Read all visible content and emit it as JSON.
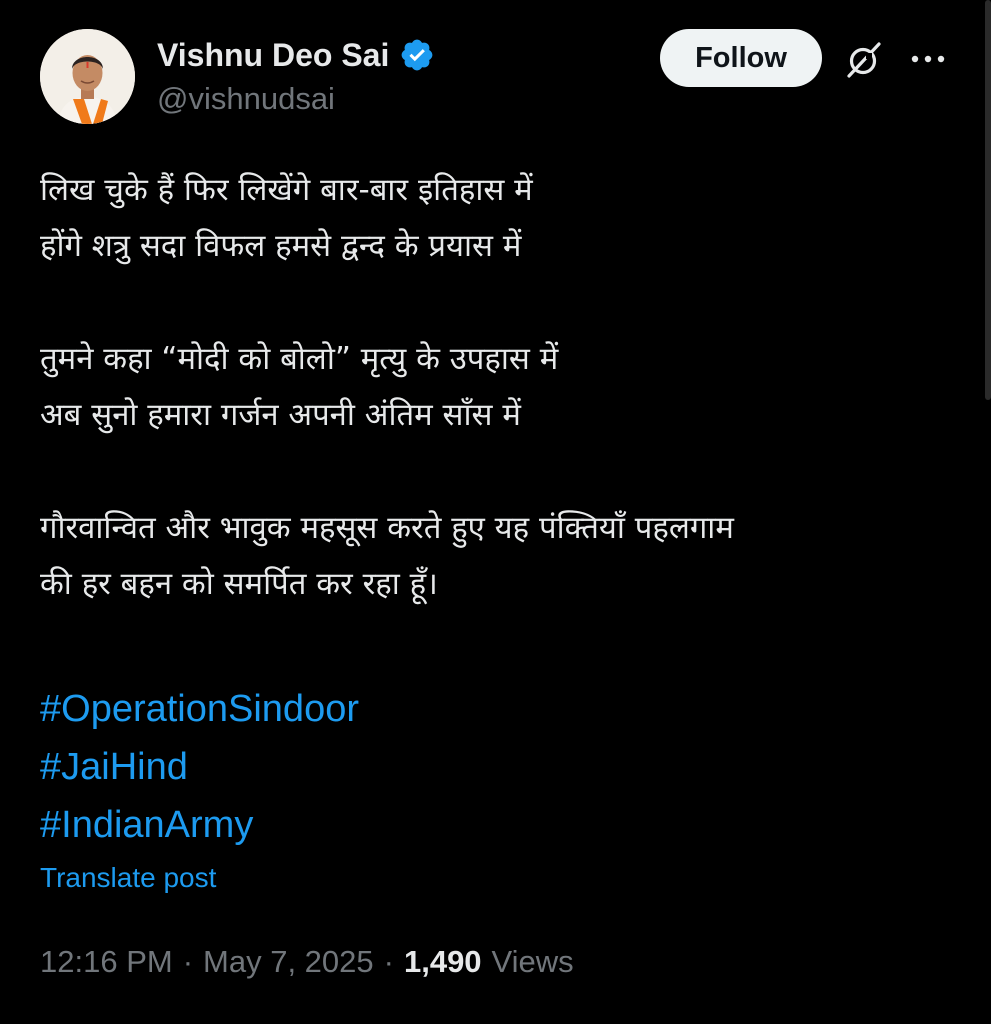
{
  "author": {
    "display_name": "Vishnu Deo Sai",
    "handle": "@vishnudsai",
    "verified": true,
    "avatar_icon": "profile-photo"
  },
  "header": {
    "follow_label": "Follow",
    "grok_icon": "grok-slash-icon",
    "more_icon": "more-dots-icon"
  },
  "post": {
    "stanzas": [
      {
        "lines": [
          "लिख चुके हैं फिर लिखेंगे बार-बार इतिहास में",
          "होंगे शत्रु सदा विफल हमसे द्वन्द के प्रयास में"
        ]
      },
      {
        "lines": [
          "तुमने कहा “मोदी को बोलो” मृत्यु के उपहास में",
          "अब सुनो हमारा गर्जन अपनी अंतिम साँस में"
        ]
      },
      {
        "lines": [
          "गौरवान्वित और भावुक महसूस करते हुए यह पंक्तियाँ पहलगाम",
          "की हर बहन को समर्पित कर रहा हूँ।"
        ]
      }
    ],
    "hashtags": [
      "#OperationSindoor",
      "#JaiHind",
      "#IndianArmy"
    ],
    "translate_label": "Translate post"
  },
  "meta": {
    "time": "12:16 PM",
    "separator": "·",
    "date": "May 7, 2025",
    "views_count": "1,490",
    "views_label": "Views"
  },
  "colors": {
    "background": "#000000",
    "text": "#e7e9ea",
    "secondary": "#71767b",
    "link": "#1d9bf0",
    "verified_badge": "#1d9bf0",
    "follow_bg": "#eff3f4"
  }
}
